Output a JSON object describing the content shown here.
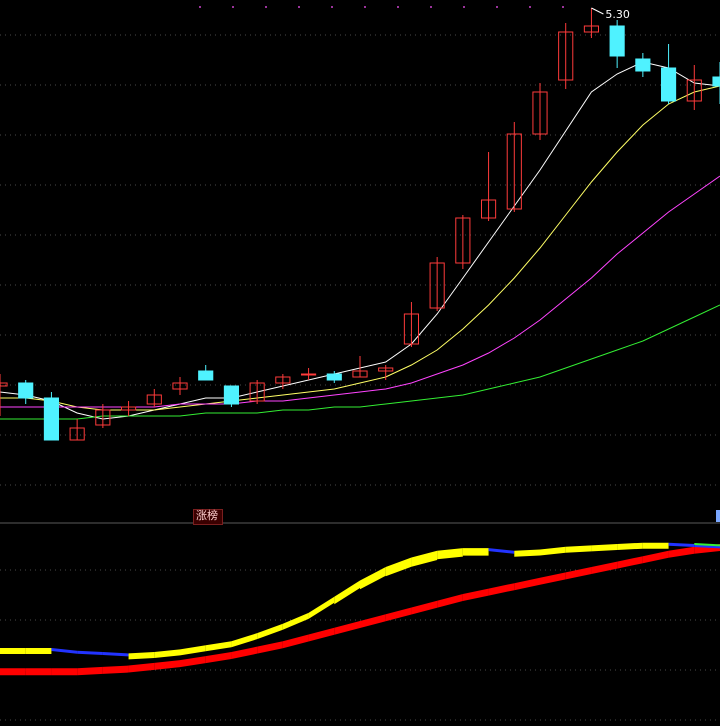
{
  "chart_data": [
    {
      "type": "candlestick",
      "panel": "price",
      "annotations": {
        "high_label": "5.30"
      },
      "colors": {
        "up": "#ff3b3b",
        "down": "#4ff2ff"
      },
      "candles": [
        {
          "o": 4.04,
          "h": 4.08,
          "l": 3.94,
          "c": 4.05
        },
        {
          "o": 4.05,
          "h": 4.06,
          "l": 3.98,
          "c": 4.0
        },
        {
          "o": 4.0,
          "h": 4.02,
          "l": 3.86,
          "c": 3.86
        },
        {
          "o": 3.86,
          "h": 3.93,
          "l": 3.86,
          "c": 3.9
        },
        {
          "o": 3.91,
          "h": 3.98,
          "l": 3.9,
          "c": 3.96
        },
        {
          "o": 3.96,
          "h": 3.99,
          "l": 3.94,
          "c": 3.97
        },
        {
          "o": 3.98,
          "h": 4.03,
          "l": 3.97,
          "c": 4.01
        },
        {
          "o": 4.03,
          "h": 4.07,
          "l": 4.01,
          "c": 4.05
        },
        {
          "o": 4.09,
          "h": 4.11,
          "l": 4.06,
          "c": 4.06
        },
        {
          "o": 4.04,
          "h": 4.04,
          "l": 3.97,
          "c": 3.98
        },
        {
          "o": 3.99,
          "h": 4.06,
          "l": 3.98,
          "c": 4.05
        },
        {
          "o": 4.05,
          "h": 4.08,
          "l": 4.03,
          "c": 4.07
        },
        {
          "o": 4.08,
          "h": 4.1,
          "l": 4.06,
          "c": 4.08
        },
        {
          "o": 4.08,
          "h": 4.09,
          "l": 4.05,
          "c": 4.06
        },
        {
          "o": 4.07,
          "h": 4.14,
          "l": 4.07,
          "c": 4.09
        },
        {
          "o": 4.09,
          "h": 4.11,
          "l": 4.06,
          "c": 4.1
        },
        {
          "o": 4.18,
          "h": 4.32,
          "l": 4.17,
          "c": 4.28
        },
        {
          "o": 4.3,
          "h": 4.47,
          "l": 4.29,
          "c": 4.45
        },
        {
          "o": 4.45,
          "h": 4.61,
          "l": 4.43,
          "c": 4.6
        },
        {
          "o": 4.6,
          "h": 4.82,
          "l": 4.59,
          "c": 4.66
        },
        {
          "o": 4.63,
          "h": 4.92,
          "l": 4.62,
          "c": 4.88
        },
        {
          "o": 4.88,
          "h": 5.05,
          "l": 4.86,
          "c": 5.02
        },
        {
          "o": 5.06,
          "h": 5.25,
          "l": 5.03,
          "c": 5.22
        },
        {
          "o": 5.22,
          "h": 5.3,
          "l": 5.2,
          "c": 5.24
        },
        {
          "o": 5.24,
          "h": 5.26,
          "l": 5.1,
          "c": 5.14
        },
        {
          "o": 5.13,
          "h": 5.15,
          "l": 5.07,
          "c": 5.09
        },
        {
          "o": 5.1,
          "h": 5.18,
          "l": 4.98,
          "c": 4.99
        },
        {
          "o": 4.99,
          "h": 5.11,
          "l": 4.96,
          "c": 5.06
        },
        {
          "o": 5.07,
          "h": 5.12,
          "l": 4.98,
          "c": 5.04
        }
      ]
    },
    {
      "type": "line",
      "panel": "price",
      "series": [
        {
          "color": "#ffffff",
          "values": [
            4.02,
            4.01,
            3.99,
            3.95,
            3.93,
            3.94,
            3.96,
            3.98,
            4.0,
            4.0,
            4.02,
            4.04,
            4.06,
            4.08,
            4.1,
            4.12,
            4.18,
            4.28,
            4.4,
            4.52,
            4.64,
            4.76,
            4.89,
            5.02,
            5.08,
            5.12,
            5.1,
            5.05,
            5.04
          ]
        },
        {
          "color": "#ffff66",
          "values": [
            4.0,
            4.0,
            3.99,
            3.97,
            3.96,
            3.96,
            3.96,
            3.97,
            3.98,
            3.99,
            4.0,
            4.01,
            4.02,
            4.03,
            4.05,
            4.07,
            4.11,
            4.16,
            4.23,
            4.31,
            4.4,
            4.5,
            4.61,
            4.72,
            4.82,
            4.91,
            4.98,
            5.02,
            5.04
          ]
        },
        {
          "color": "#ff44ff",
          "values": [
            3.97,
            3.97,
            3.97,
            3.97,
            3.97,
            3.97,
            3.97,
            3.98,
            3.98,
            3.98,
            3.99,
            3.99,
            4.0,
            4.01,
            4.02,
            4.03,
            4.05,
            4.08,
            4.11,
            4.15,
            4.2,
            4.26,
            4.33,
            4.4,
            4.48,
            4.55,
            4.62,
            4.68,
            4.74
          ]
        },
        {
          "color": "#33ee33",
          "values": [
            3.93,
            3.93,
            3.93,
            3.93,
            3.94,
            3.94,
            3.94,
            3.94,
            3.95,
            3.95,
            3.95,
            3.96,
            3.96,
            3.97,
            3.97,
            3.98,
            3.99,
            4.0,
            4.01,
            4.03,
            4.05,
            4.07,
            4.1,
            4.13,
            4.16,
            4.19,
            4.23,
            4.27,
            4.31
          ]
        }
      ]
    },
    {
      "type": "area",
      "panel": "indicator",
      "series": [
        {
          "color": "#ffff00",
          "segment_colors": [
            "#ffff00",
            "#2233ff",
            "#33ee33"
          ],
          "values": [
            20,
            20,
            20,
            18,
            17,
            16,
            17,
            19,
            22,
            25,
            31,
            38,
            46,
            58,
            70,
            80,
            87,
            92,
            94,
            94,
            92,
            93,
            95,
            96,
            97,
            98,
            98,
            97,
            96
          ]
        },
        {
          "color": "#ff0000",
          "values": [
            5,
            5,
            5,
            5,
            6,
            7,
            9,
            11,
            14,
            17,
            21,
            25,
            30,
            35,
            40,
            45,
            50,
            55,
            60,
            64,
            68,
            72,
            76,
            80,
            84,
            88,
            92,
            95,
            97
          ]
        }
      ]
    }
  ],
  "indicator_badge": {
    "label": "涨榜",
    "colors": {
      "fill": "#3a0000",
      "border": "#7a1f1f",
      "text": "#ffd0d0"
    }
  }
}
